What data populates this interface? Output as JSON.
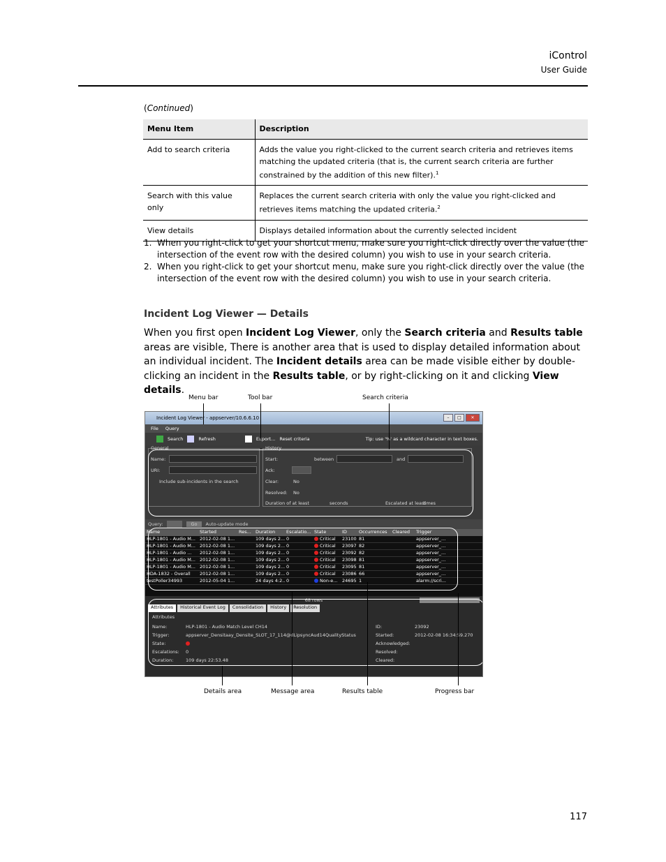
{
  "header": {
    "title": "iControl",
    "subtitle": "User Guide"
  },
  "continued": "Continued",
  "table": {
    "col1": "Menu Item",
    "col2": "Description",
    "rows": [
      {
        "item": "Add to search criteria",
        "desc": "Adds the value you right-clicked to the current search criteria and retrieves items matching the updated criteria (that is, the current search criteria are further constrained by the addition of this new filter).",
        "note": "1"
      },
      {
        "item": "Search with this value only",
        "desc": "Replaces the current search criteria with only the value you right-clicked and retrieves items matching the updated criteria.",
        "note": "2"
      },
      {
        "item": "View details",
        "desc": "Displays detailed information about the currently selected incident",
        "note": ""
      }
    ]
  },
  "footnotes": [
    {
      "num": "1.",
      "text": "When you right-click to get your shortcut menu, make sure you right-click directly over the value (the intersection of the event row with the desired column) you wish to use in your search criteria."
    },
    {
      "num": "2.",
      "text": "When you right-click to get your shortcut menu, make sure you right-click directly over the value (the intersection of the event row with the desired column) you wish to use in your search criteria."
    }
  ],
  "section_heading": "Incident Log Viewer — Details",
  "paragraph": {
    "p1": "When you first open ",
    "b1": "Incident Log Viewer",
    "p2": ", only the ",
    "b2": "Search criteria",
    "p3": " and ",
    "b3": "Results table",
    "p4": " areas are visible, There is another area that is used to display detailed information about an individual incident. The ",
    "b4": "Incident details",
    "p5": " area can be made visible either by double-clicking an incident in the ",
    "b5": "Results table",
    "p6": ", or by right-clicking on it and clicking ",
    "b6": "View details",
    "p7": "."
  },
  "callouts": {
    "menu_bar": "Menu bar",
    "tool_bar": "Tool bar",
    "search_criteria": "Search criteria",
    "details_area": "Details area",
    "message_area": "Message area",
    "results_table": "Results table",
    "progress_bar": "Progress bar"
  },
  "screenshot": {
    "window_title": "Incident Log Viewer - appserver/10.6.6.10",
    "menu": [
      "File",
      "Query"
    ],
    "toolbar": {
      "search": "Search",
      "refresh": "Refresh",
      "export": "Export...",
      "reset": "Reset criteria",
      "tip": "Tip: use '%' as a wildcard character in text boxes."
    },
    "general": {
      "legend": "General",
      "name": "Name:",
      "uri": "URI:",
      "subincidents": "Include sub-incidents in the search"
    },
    "history": {
      "legend": "History",
      "start": "Start:",
      "between": "between",
      "and": "and",
      "ack": "Ack:",
      "clear": "Clear:",
      "resolved": "Resolved:",
      "no": "No",
      "duration": "Duration of at least",
      "seconds": "seconds",
      "escalated": "Escalated at least",
      "times": "times"
    },
    "querybar": {
      "query": "Query:",
      "go": "Go",
      "autoupdate": "Auto-update mode"
    },
    "columns": [
      "Name",
      "Started",
      "Res...",
      "Duration",
      "Escalatio...",
      "State",
      "ID",
      "Occurrences",
      "Cleared",
      "Trigger"
    ],
    "rows": [
      [
        "HLP-1801 - Audio M...",
        "2012-02-08 1...",
        "",
        "109 days 2...",
        "0",
        "red",
        "Critical",
        "23100",
        "81",
        "",
        "appserver_..."
      ],
      [
        "HLP-1801 - Audio M...",
        "2012-02-08 1...",
        "",
        "109 days 2...",
        "0",
        "red",
        "Critical",
        "23097",
        "82",
        "",
        "appserver_..."
      ],
      [
        "HLP-1801 - Audio ...",
        "2012-02-08 1...",
        "",
        "109 days 2...",
        "0",
        "red",
        "Critical",
        "23092",
        "82",
        "",
        "appserver_..."
      ],
      [
        "HLP-1801 - Audio M...",
        "2012-02-08 1...",
        "",
        "109 days 2...",
        "0",
        "red",
        "Critical",
        "23098",
        "81",
        "",
        "appserver_..."
      ],
      [
        "HLP-1801 - Audio M...",
        "2012-02-08 1...",
        "",
        "109 days 2...",
        "0",
        "red",
        "Critical",
        "23095",
        "81",
        "",
        "appserver_..."
      ],
      [
        "HDA-1832 - Overall",
        "2012-02-08 1...",
        "",
        "109 days 2...",
        "0",
        "red",
        "Critical",
        "23086",
        "66",
        "",
        "appserver_..."
      ],
      [
        "testPoller34993",
        "2012-05-04 1...",
        "",
        "24 days 4:2...",
        "0",
        "blue",
        "Non-e...",
        "24695",
        "1",
        "",
        "alarm://scri..."
      ]
    ],
    "rowcount": "68 rows",
    "tabs": [
      "Attributes",
      "Historical Event Log",
      "Consolidation",
      "History",
      "Resolution"
    ],
    "attributes_title": "Attributes",
    "details": {
      "name_label": "Name:",
      "name": "HLP-1801 - Audio Match Level CH14",
      "trigger_label": "Trigger:",
      "trigger": "appserver_Densitaay_Densite_SLOT_17_114@dLipsyncAud14QualityStatus",
      "state_label": "State:",
      "escalations_label": "Escalations:",
      "escalations": "0",
      "duration_label": "Duration:",
      "duration": "109 days 22:53.48",
      "id_label": "ID:",
      "id": "23092",
      "started_label": "Started:",
      "started": "2012-02-08 16:34:59.270",
      "ack_label": "Acknowledged:",
      "resolved_label": "Resolved:",
      "cleared_label": "Cleared:"
    }
  },
  "page_number": "117"
}
